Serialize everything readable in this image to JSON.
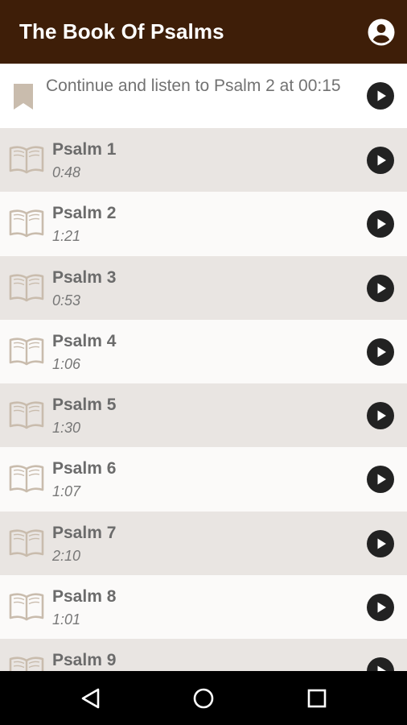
{
  "appbar": {
    "title": "The Book Of Psalms",
    "account_icon": "account-circle-icon"
  },
  "continue": {
    "text": "Continue and listen to Psalm 2 at 00:15",
    "icon": "bookmark-icon"
  },
  "psalms": [
    {
      "title": "Psalm 1",
      "duration": "0:48"
    },
    {
      "title": "Psalm 2",
      "duration": "1:21"
    },
    {
      "title": "Psalm 3",
      "duration": "0:53"
    },
    {
      "title": "Psalm 4",
      "duration": "1:06"
    },
    {
      "title": "Psalm 5",
      "duration": "1:30"
    },
    {
      "title": "Psalm 6",
      "duration": "1:07"
    },
    {
      "title": "Psalm 7",
      "duration": "2:10"
    },
    {
      "title": "Psalm 8",
      "duration": "1:01"
    },
    {
      "title": "Psalm 9",
      "duration": ""
    }
  ],
  "navbar": {
    "back_icon": "back-triangle-icon",
    "home_icon": "home-circle-icon",
    "recents_icon": "recents-square-icon"
  },
  "colors": {
    "appbar": "#3e1e08",
    "row_odd": "#e9e5e2",
    "row_even": "#fbfaf9",
    "icon_tan": "#c9bcad",
    "play": "#222222"
  }
}
